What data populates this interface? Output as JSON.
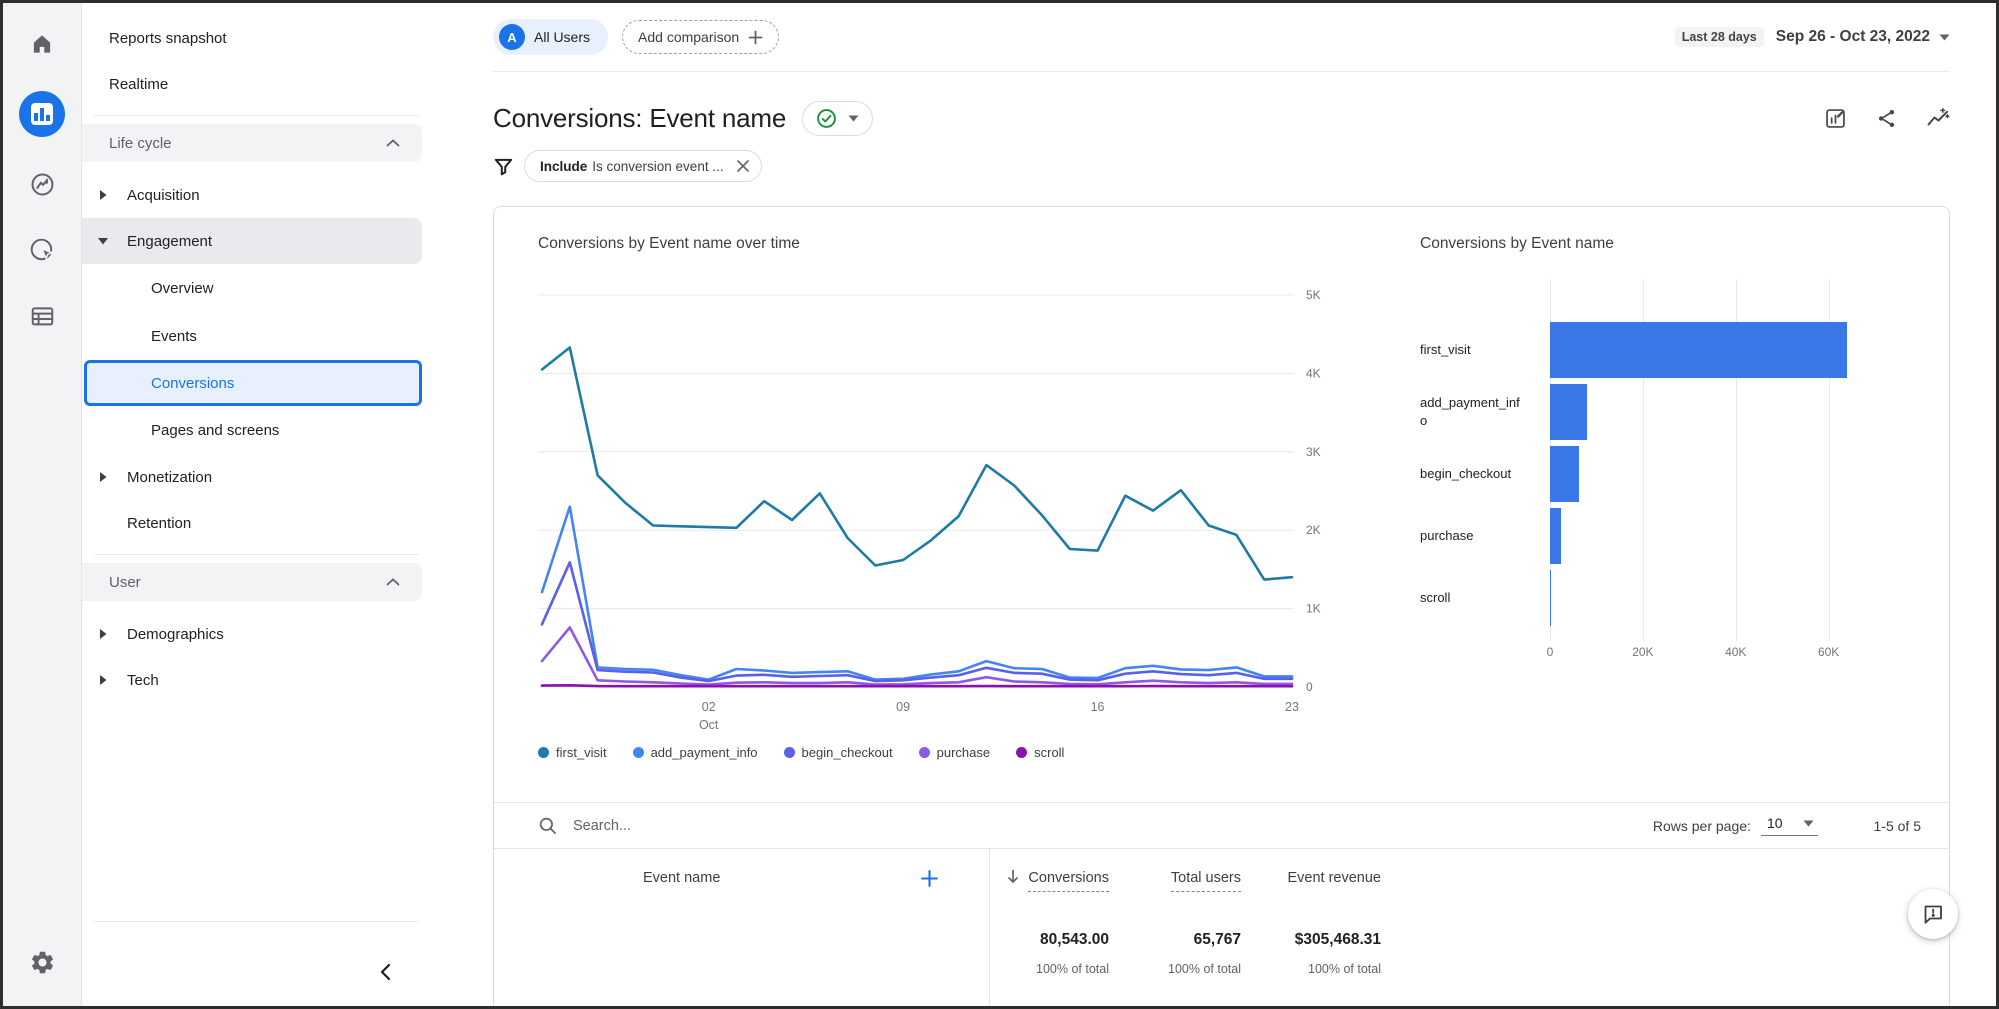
{
  "header": {
    "avatar_letter": "A",
    "all_users": "All Users",
    "add_comparison": "Add comparison",
    "date_range_label": "Last 28 days",
    "date_range": "Sep 26 - Oct 23, 2022",
    "title": "Conversions: Event name"
  },
  "sidebar": {
    "reports_snapshot": "Reports snapshot",
    "realtime": "Realtime",
    "life_cycle": "Life cycle",
    "acquisition": "Acquisition",
    "engagement": "Engagement",
    "overview": "Overview",
    "events": "Events",
    "conversions": "Conversions",
    "pages_and_screens": "Pages and screens",
    "monetization": "Monetization",
    "retention": "Retention",
    "user": "User",
    "demographics": "Demographics",
    "tech": "Tech"
  },
  "filter": {
    "include_label": "Include",
    "condition": "Is conversion event ..."
  },
  "table": {
    "search_placeholder": "Search...",
    "rows_per_page_label": "Rows per page:",
    "rows_per_page_value": "10",
    "pagination": "1-5 of 5",
    "columns": {
      "event_name": "Event name",
      "conversions": "Conversions",
      "total_users": "Total users",
      "event_revenue": "Event revenue"
    },
    "totals": {
      "conversions": "80,543.00",
      "total_users": "65,767",
      "event_revenue": "$305,468.31",
      "of_total": "100% of total"
    }
  },
  "colors": {
    "accent": "#1a73e8",
    "selected_bg": "#e8f0fe",
    "check_green": "#1e8e3e"
  },
  "icons": {
    "rail": [
      "home-icon",
      "reports-icon",
      "explore-icon",
      "advertising-icon",
      "library-icon",
      "admin-gear-icon"
    ],
    "header": [
      "check-circle-icon",
      "dropdown-caret-icon",
      "customize-report-icon",
      "share-icon",
      "insights-icon"
    ],
    "other": [
      "funnel-icon",
      "close-icon",
      "search-icon",
      "add-plus-icon",
      "sort-desc-icon",
      "feedback-icon",
      "collapse-sidebar-icon"
    ]
  },
  "chart_data": [
    {
      "type": "line",
      "title": "Conversions by Event name over time",
      "x_range": "Sep 26 - Oct 23, 2022 (28 daily points)",
      "x_ticks": [
        {
          "i": 6,
          "label": "02",
          "sub": "Oct"
        },
        {
          "i": 13,
          "label": "09"
        },
        {
          "i": 20,
          "label": "16"
        },
        {
          "i": 27,
          "label": "23"
        }
      ],
      "y_ticks": [
        "0",
        "1K",
        "2K",
        "3K",
        "4K",
        "5K"
      ],
      "ylim": [
        0,
        5000
      ],
      "grid": true,
      "legend_position": "bottom",
      "series": [
        {
          "name": "first_visit",
          "color": "#1d7ba6",
          "values": [
            4050,
            4330,
            2700,
            2350,
            2060,
            2050,
            2040,
            2030,
            2370,
            2130,
            2470,
            1900,
            1550,
            1620,
            1870,
            2180,
            2830,
            2570,
            2190,
            1760,
            1740,
            2440,
            2250,
            2510,
            2060,
            1940,
            1370,
            1400
          ]
        },
        {
          "name": "add_payment_info",
          "color": "#4285f4",
          "values": [
            1210,
            2300,
            250,
            230,
            220,
            150,
            95,
            230,
            210,
            180,
            190,
            200,
            95,
            105,
            160,
            200,
            330,
            240,
            230,
            120,
            115,
            240,
            270,
            225,
            215,
            250,
            135,
            135
          ]
        },
        {
          "name": "begin_checkout",
          "color": "#5b5fe9",
          "values": [
            800,
            1590,
            215,
            195,
            185,
            120,
            75,
            145,
            155,
            130,
            140,
            150,
            75,
            85,
            120,
            150,
            245,
            180,
            170,
            95,
            85,
            170,
            200,
            165,
            150,
            180,
            105,
            105
          ]
        },
        {
          "name": "purchase",
          "color": "#8f5ae3",
          "values": [
            330,
            760,
            85,
            70,
            60,
            45,
            30,
            55,
            60,
            50,
            50,
            60,
            30,
            35,
            50,
            60,
            125,
            70,
            60,
            40,
            35,
            60,
            80,
            60,
            50,
            60,
            40,
            40
          ]
        },
        {
          "name": "scroll",
          "color": "#8c10b0",
          "values": [
            18,
            22,
            12,
            10,
            10,
            10,
            10,
            10,
            10,
            10,
            10,
            10,
            10,
            10,
            10,
            10,
            12,
            10,
            10,
            10,
            10,
            10,
            12,
            10,
            10,
            10,
            10,
            10
          ]
        }
      ]
    },
    {
      "type": "bar",
      "orientation": "horizontal",
      "title": "Conversions by Event name",
      "categories": [
        "first_visit",
        "add_payment_info",
        "begin_checkout",
        "purchase",
        "scroll"
      ],
      "values": [
        63900,
        8000,
        6300,
        2400,
        150
      ],
      "x_ticks": [
        {
          "v": 0,
          "label": "0"
        },
        {
          "v": 20000,
          "label": "20K"
        },
        {
          "v": 40000,
          "label": "40K"
        },
        {
          "v": 60000,
          "label": "60K"
        }
      ],
      "xmax": 73000,
      "bar_color": "#3b78e7"
    }
  ]
}
